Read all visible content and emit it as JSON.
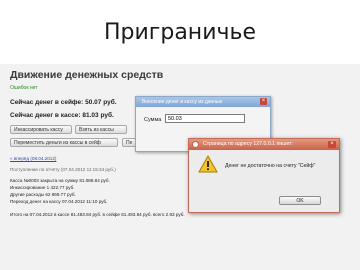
{
  "slide": {
    "title": "Приграничье"
  },
  "page": {
    "heading": "Движение денежных средств",
    "status": "Ошибок нет",
    "safe_balance": "Сейчас денег в сейфе: 50.07 руб.",
    "cash_balance": "Сейчас денег в кассе: 81.03 руб.",
    "buttons": [
      "Инкассировать кассу",
      "Взять из кассы",
      "Переместить деньги из кассы в сейф",
      "Пе"
    ],
    "report_link": "« вперёд (08.04.2012)",
    "lines": [
      "Поступление по отчёту (07.04.2012 11:15:34 руб.)",
      "Касса №0003 закрыта на сумму 81.088.84 руб.",
      "Инкассирование 1 422.77 руб.",
      "Другие расходы 62 869.77 руб.",
      "Переход денег на кассу 07.04.2012 11:10 руб.",
      "Итого на 07.04.2012 в кассе 81.483.84 руб. в сейфе 81.483.84 руб. всего 2.93 руб."
    ]
  },
  "input_dialog": {
    "title": "Внесение денег в кассу из данные",
    "label": "Сумма",
    "value": "50.03"
  },
  "alert_dialog": {
    "title": "Страница по адресу 127.0.0.1 пишет:",
    "message": "Денег не достаточно на счету \"Сейф\"",
    "ok_label": "OK"
  },
  "colors": {
    "heading": "#3a3a3a",
    "status_ok": "#2a8a2a",
    "alert_title": "#c9634a",
    "input_title": "#7fa6d8"
  }
}
